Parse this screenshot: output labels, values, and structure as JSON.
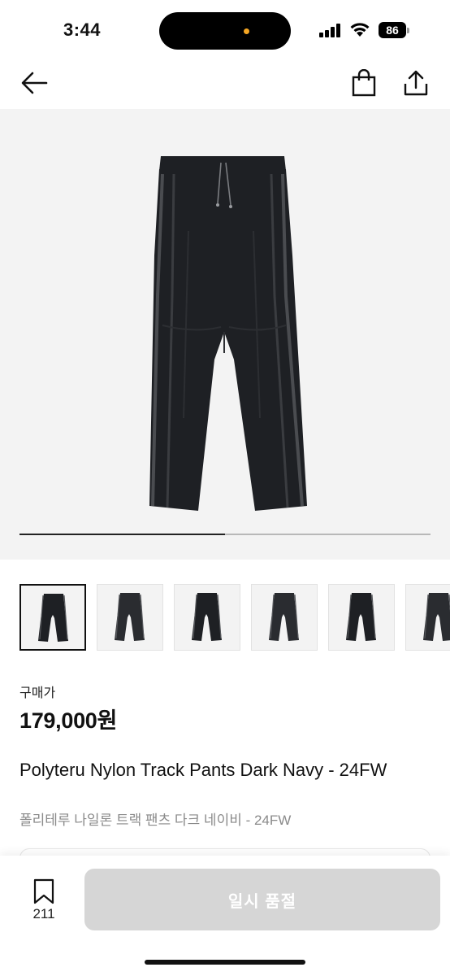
{
  "status_bar": {
    "time": "3:44",
    "battery": "86"
  },
  "nav": {
    "back_icon": "arrow-left-icon",
    "cart_icon": "shopping-bag-icon",
    "share_icon": "share-icon"
  },
  "gallery": {
    "progress": 0.5,
    "thumbnail_count": 6,
    "active_index": 0
  },
  "product": {
    "price_label": "구매가",
    "price": "179,000원",
    "title": "Polyteru Nylon Track Pants Dark Navy - 24FW",
    "subtitle": "폴리테루 나일론 트랙 팬츠 다크 네이비 - 24FW"
  },
  "bottom_bar": {
    "bookmark_count": "211",
    "button_label": "일시 품절"
  },
  "colors": {
    "pants": "#1e2024",
    "button_disabled": "#d6d6d6",
    "background_gallery": "#f3f3f3"
  }
}
